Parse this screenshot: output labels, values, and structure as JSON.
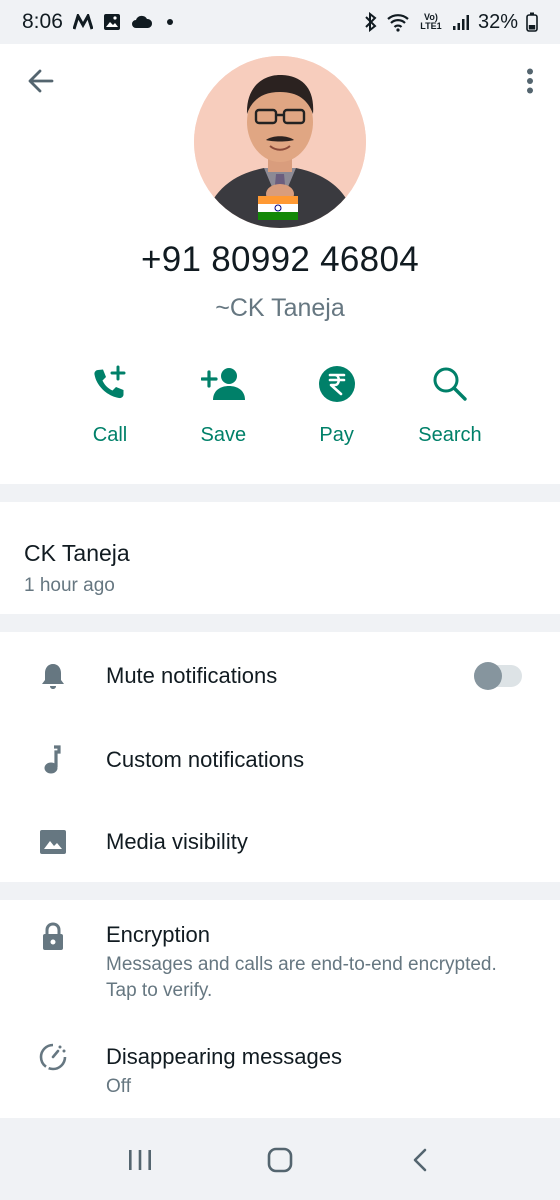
{
  "status_bar": {
    "time": "8:06",
    "battery": "32%",
    "network_label": "Vo) LTE1",
    "icons": [
      "m-logo-icon",
      "gallery-icon",
      "cloud-icon",
      "dot-icon",
      "bluetooth-icon",
      "wifi-icon",
      "signal-icon"
    ]
  },
  "header": {
    "back_icon": "arrow-left-icon",
    "more_icon": "more-vertical-icon",
    "phone": "+91 80992 46804",
    "display_name": "~CK Taneja"
  },
  "actions": [
    {
      "label": "Call",
      "icon": "add-call-icon"
    },
    {
      "label": "Save",
      "icon": "add-contact-icon"
    },
    {
      "label": "Pay",
      "icon": "rupee-icon"
    },
    {
      "label": "Search",
      "icon": "search-icon"
    }
  ],
  "about": {
    "name": "CK Taneja",
    "time": "1 hour ago"
  },
  "settings": {
    "mute_label": "Mute notifications",
    "mute_enabled": false,
    "custom_label": "Custom notifications",
    "media_label": "Media visibility"
  },
  "encryption": {
    "title": "Encryption",
    "subtitle": "Messages and calls are end-to-end encrypted. Tap to verify.",
    "disappearing_title": "Disappearing messages",
    "disappearing_value": "Off"
  },
  "colors": {
    "accent": "#008069",
    "icon_gray": "#667781",
    "background": "#f0f2f5",
    "card": "#ffffff"
  },
  "nav_bar": {
    "icons": [
      "recent-apps-icon",
      "home-icon",
      "back-nav-icon"
    ]
  }
}
